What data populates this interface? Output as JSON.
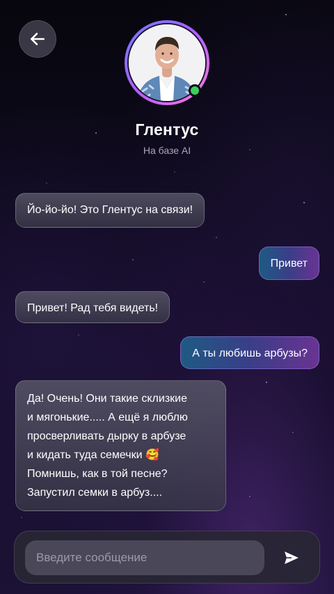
{
  "header": {
    "back_icon": "arrow-left-icon",
    "name": "Глентус",
    "subtitle": "На базе AI",
    "status": "online",
    "status_color": "#3ad15a"
  },
  "messages": [
    {
      "sender": "bot",
      "text": "Йо-йо-йо! Это Глентус на связи!"
    },
    {
      "sender": "user",
      "text": "Привет"
    },
    {
      "sender": "bot",
      "text": "Привет! Рад тебя видеть!"
    },
    {
      "sender": "user",
      "text": "А ты любишь арбузы?"
    },
    {
      "sender": "bot",
      "lines": [
        "Да! Очень! Они такие склизкие",
        "и мягонькие..... А ещё я люблю",
        "просверливать дырку в арбузе",
        "и кидать туда семечки 🥰",
        "Помнишь, как в той песне?",
        "Запустил семки в арбуз...."
      ]
    }
  ],
  "composer": {
    "placeholder": "Введите сообщение",
    "value": "",
    "send_icon": "send-icon"
  },
  "colors": {
    "user_bubble_start": "#1e5a84",
    "user_bubble_end": "#6a3393",
    "avatar_ring": "#b25cff"
  }
}
